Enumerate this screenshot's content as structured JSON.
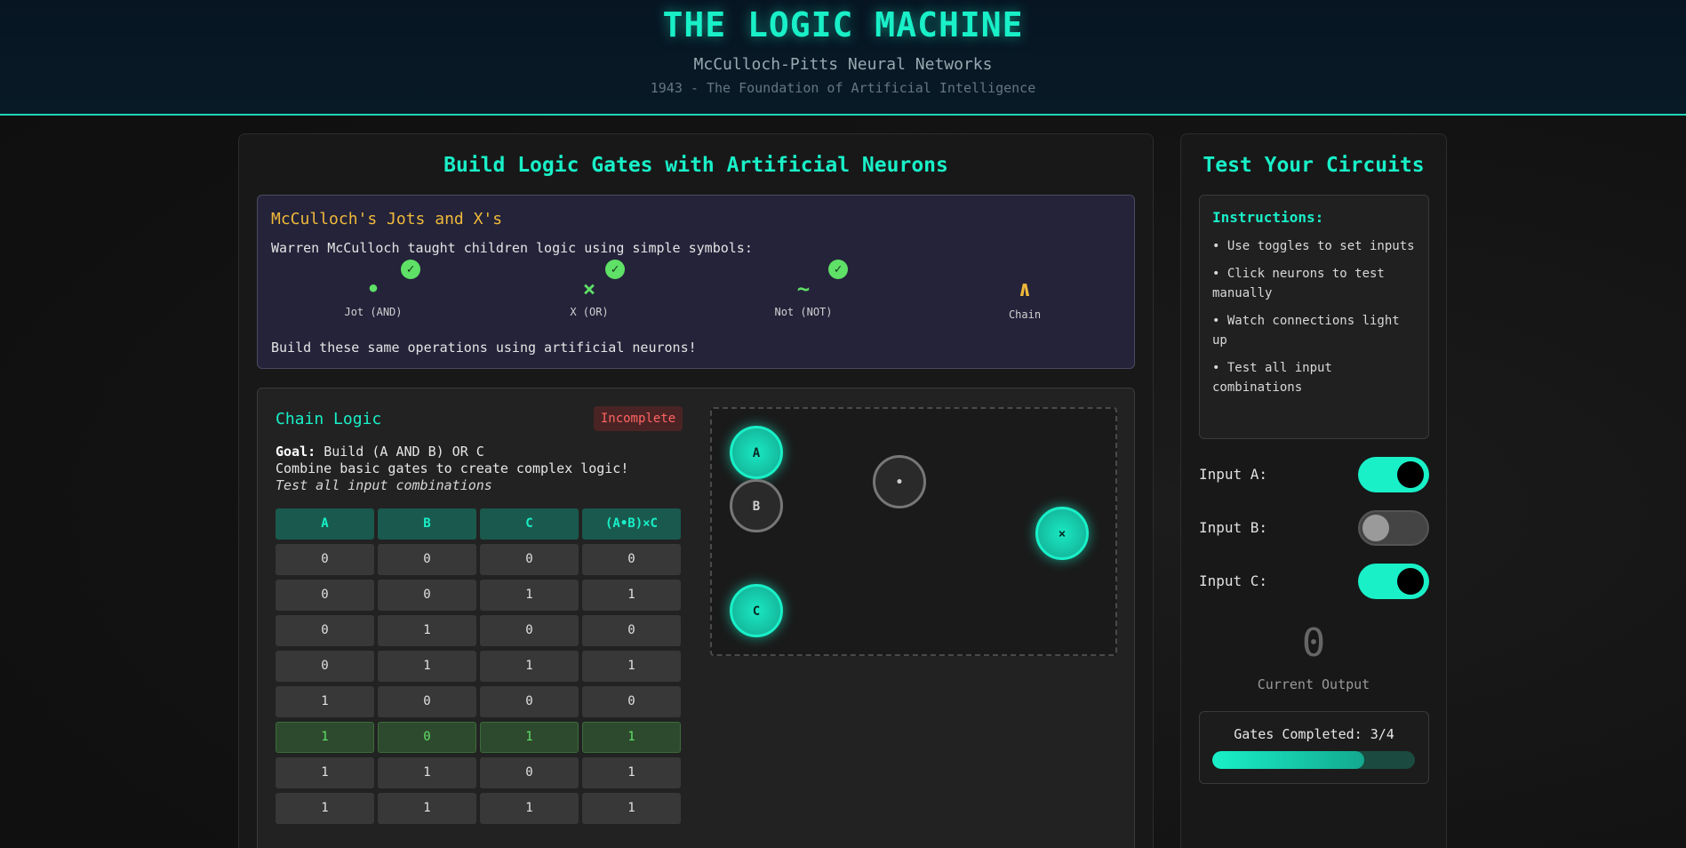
{
  "header": {
    "title": "THE LOGIC MACHINE",
    "subtitle": "McCulloch-Pitts Neural Networks",
    "year_line": "1943 - The Foundation of Artificial Intelligence"
  },
  "main": {
    "title": "Build Logic Gates with Artificial Neurons",
    "jots": {
      "title": "McCulloch's Jots and X's",
      "intro": "Warren McCulloch taught children logic using simple symbols:",
      "outro": "Build these same operations using artificial neurons!",
      "symbols": [
        {
          "glyph": "•",
          "label": "Jot (AND)",
          "completed": true,
          "icon": "jot-icon"
        },
        {
          "glyph": "×",
          "label": "X (OR)",
          "completed": true,
          "icon": "x-icon"
        },
        {
          "glyph": "~",
          "label": "Not (NOT)",
          "completed": true,
          "icon": "not-icon"
        },
        {
          "glyph": "∧",
          "label": "Chain",
          "completed": false,
          "icon": "chain-icon"
        }
      ],
      "check_glyph": "✓"
    },
    "challenge": {
      "title": "Chain Logic",
      "status": "Incomplete",
      "goal_label": "Goal:",
      "goal_text": "Build (A AND B) OR C",
      "description": "Combine basic gates to create complex logic!",
      "hint": "Test all input combinations",
      "truth_table": {
        "headers": [
          "A",
          "B",
          "C",
          "(A•B)×C"
        ],
        "rows": [
          [
            "0",
            "0",
            "0",
            "0"
          ],
          [
            "0",
            "0",
            "1",
            "1"
          ],
          [
            "0",
            "1",
            "0",
            "0"
          ],
          [
            "0",
            "1",
            "1",
            "1"
          ],
          [
            "1",
            "0",
            "0",
            "0"
          ],
          [
            "1",
            "0",
            "1",
            "1"
          ],
          [
            "1",
            "1",
            "0",
            "1"
          ],
          [
            "1",
            "1",
            "1",
            "1"
          ]
        ],
        "highlighted_row": 5
      },
      "neurons": {
        "a": {
          "label": "A",
          "active": true
        },
        "b": {
          "label": "B",
          "active": false
        },
        "and_gate": {
          "label": "•",
          "active": false
        },
        "or_gate": {
          "label": "×",
          "active": true
        },
        "c": {
          "label": "C",
          "active": true
        }
      }
    }
  },
  "side": {
    "title": "Test Your Circuits",
    "instructions_title": "Instructions:",
    "instructions": [
      "• Use toggles to set inputs",
      "• Click neurons to test manually",
      "• Watch connections light up",
      "• Test all input combinations"
    ],
    "inputs": [
      {
        "label": "Input A:",
        "on": true
      },
      {
        "label": "Input B:",
        "on": false
      },
      {
        "label": "Input C:",
        "on": true
      }
    ],
    "current_output": "0",
    "output_label": "Current Output",
    "progress_label": "Gates Completed: 3/4",
    "progress_fraction": 0.75
  },
  "colors": {
    "accent": "#19f0c8",
    "warning": "#f0b93a",
    "success": "#5fe067",
    "error": "#ff6464"
  }
}
